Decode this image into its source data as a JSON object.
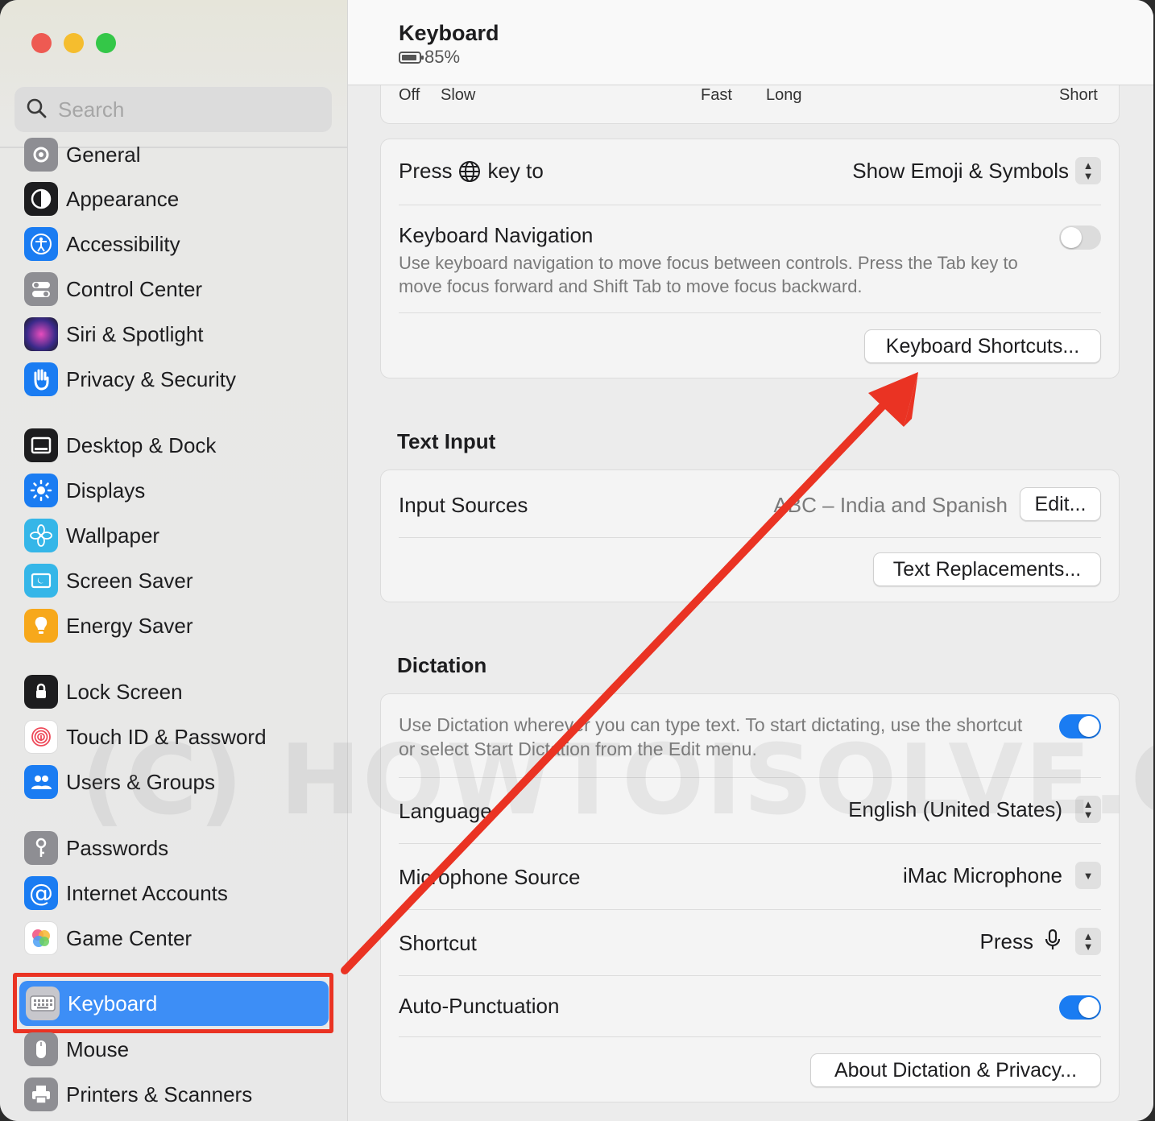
{
  "sidebar": {
    "search_placeholder": "Search",
    "items": [
      {
        "label": "General",
        "icon": "gear-icon",
        "color": "#8e8e93"
      },
      {
        "label": "Appearance",
        "icon": "appearance-icon",
        "color": "#1d1d1f"
      },
      {
        "label": "Accessibility",
        "icon": "accessibility-icon",
        "color": "#1a7cf2"
      },
      {
        "label": "Control Center",
        "icon": "control-center-icon",
        "color": "#8e8e93"
      },
      {
        "label": "Siri & Spotlight",
        "icon": "siri-icon",
        "color": "#6b3fc7"
      },
      {
        "label": "Privacy & Security",
        "icon": "hand-icon",
        "color": "#1a7cf2"
      },
      {
        "label": "Desktop & Dock",
        "icon": "dock-icon",
        "color": "#1d1d1f"
      },
      {
        "label": "Displays",
        "icon": "sun-icon",
        "color": "#1a7cf2"
      },
      {
        "label": "Wallpaper",
        "icon": "flower-icon",
        "color": "#35b6e8"
      },
      {
        "label": "Screen Saver",
        "icon": "screen-saver-icon",
        "color": "#35b6e8"
      },
      {
        "label": "Energy Saver",
        "icon": "bulb-icon",
        "color": "#f7a81b"
      },
      {
        "label": "Lock Screen",
        "icon": "lock-icon",
        "color": "#1d1d1f"
      },
      {
        "label": "Touch ID & Password",
        "icon": "fingerprint-icon",
        "color": "#ffffff"
      },
      {
        "label": "Users & Groups",
        "icon": "users-icon",
        "color": "#1a7cf2"
      },
      {
        "label": "Passwords",
        "icon": "key-icon",
        "color": "#8e8e93"
      },
      {
        "label": "Internet Accounts",
        "icon": "at-icon",
        "color": "#1a7cf2"
      },
      {
        "label": "Game Center",
        "icon": "game-center-icon",
        "color": "#ffffff"
      },
      {
        "label": "Keyboard",
        "icon": "keyboard-icon",
        "color": "#8e8e93"
      },
      {
        "label": "Mouse",
        "icon": "mouse-icon",
        "color": "#8e8e93"
      },
      {
        "label": "Printers & Scanners",
        "icon": "printer-icon",
        "color": "#8e8e93"
      }
    ]
  },
  "header": {
    "title": "Keyboard",
    "battery": "85%"
  },
  "repeat": {
    "off": "Off",
    "slow": "Slow",
    "fast": "Fast",
    "long": "Long",
    "short": "Short"
  },
  "keyboard": {
    "press_label_pre": "Press",
    "press_label_post": "key to",
    "press_value": "Show Emoji & Symbols",
    "nav_title": "Keyboard Navigation",
    "nav_desc": "Use keyboard navigation to move focus between controls. Press the Tab key to move focus forward and Shift Tab to move focus backward.",
    "nav_enabled": false,
    "shortcuts_button": "Keyboard Shortcuts..."
  },
  "text_input": {
    "section_title": "Text Input",
    "input_sources_label": "Input Sources",
    "input_sources_value": "ABC – India and Spanish",
    "edit_button": "Edit...",
    "replacements_button": "Text Replacements..."
  },
  "dictation": {
    "section_title": "Dictation",
    "desc": "Use Dictation wherever you can type text. To start dictating, use the shortcut or select Start Dictation from the Edit menu.",
    "enabled": true,
    "language_label": "Language",
    "language_value": "English (United States)",
    "mic_label": "Microphone Source",
    "mic_value": "iMac Microphone",
    "shortcut_label": "Shortcut",
    "shortcut_value": "Press",
    "autopunct_label": "Auto-Punctuation",
    "autopunct_enabled": true,
    "about_button": "About Dictation & Privacy..."
  },
  "watermark": "(C) HOWTOISOLVE.COM",
  "colors": {
    "accent": "#1a7cf2",
    "selection": "#3d8ef6",
    "annotation": "#ea3323"
  }
}
